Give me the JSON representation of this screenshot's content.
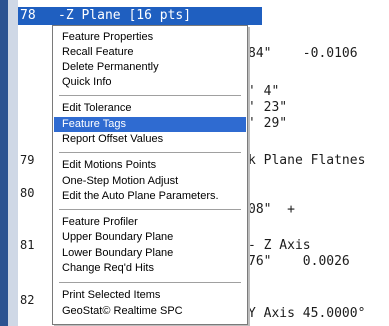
{
  "editor": {
    "highlighted_line": {
      "number": "78",
      "text": "-Z Plane [16 pts]"
    },
    "line_numbers": [
      "79",
      "80",
      "81",
      "82"
    ],
    "code_fragments": [
      {
        "text": "84\"    -0.0106"
      },
      {
        "text": "' 4\""
      },
      {
        "text": "' 23\""
      },
      {
        "text": "' 29\""
      },
      {
        "text": "k Plane Flatnes"
      },
      {
        "text": "08\"  +"
      },
      {
        "text": "- Z Axis"
      },
      {
        "text": "76\"    0.0026"
      },
      {
        "text": "Y Axis 45.0000°"
      }
    ]
  },
  "context_menu": {
    "items": [
      {
        "label": "Feature Properties"
      },
      {
        "label": "Recall Feature"
      },
      {
        "label": "Delete Permanently"
      },
      {
        "label": "Quick Info"
      },
      {
        "label": "Edit Tolerance"
      },
      {
        "label": "Feature Tags",
        "active": true
      },
      {
        "label": "Report Offset Values"
      },
      {
        "label": "Edit Motions Points"
      },
      {
        "label": "One-Step Motion Adjust"
      },
      {
        "label": "Edit the Auto Plane Parameters."
      },
      {
        "label": "Feature Profiler"
      },
      {
        "label": "Upper Boundary Plane"
      },
      {
        "label": "Lower Boundary Plane"
      },
      {
        "label": "Change Req'd Hits"
      },
      {
        "label": "Print Selected Items"
      },
      {
        "label": "GeoStat© Realtime SPC"
      }
    ]
  },
  "colors": {
    "highlight": "#1f5fc0",
    "menu_active": "#2f6bd1",
    "left_bar": "#2c5391"
  }
}
